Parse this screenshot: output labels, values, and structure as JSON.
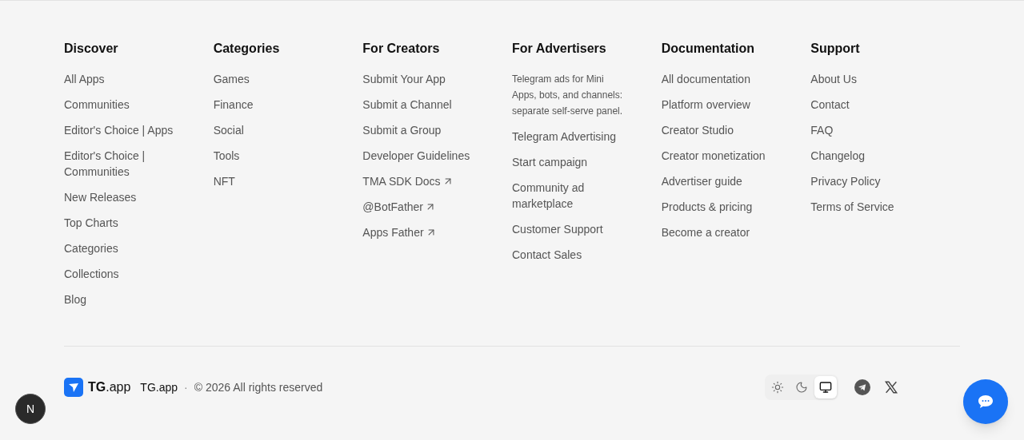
{
  "columns": [
    {
      "heading": "Discover",
      "links": [
        {
          "label": "All Apps",
          "external": false
        },
        {
          "label": "Communities",
          "external": false
        },
        {
          "label": "Editor's Choice | Apps",
          "external": false
        },
        {
          "label": "Editor's Choice | Communities",
          "external": false
        },
        {
          "label": "New Releases",
          "external": false
        },
        {
          "label": "Top Charts",
          "external": false
        },
        {
          "label": "Categories",
          "external": false
        },
        {
          "label": "Collections",
          "external": false
        },
        {
          "label": "Blog",
          "external": false
        }
      ]
    },
    {
      "heading": "Categories",
      "links": [
        {
          "label": "Games",
          "external": false
        },
        {
          "label": "Finance",
          "external": false
        },
        {
          "label": "Social",
          "external": false
        },
        {
          "label": "Tools",
          "external": false
        },
        {
          "label": "NFT",
          "external": false
        }
      ]
    },
    {
      "heading": "For Creators",
      "links": [
        {
          "label": "Submit Your App",
          "external": false
        },
        {
          "label": "Submit a Channel",
          "external": false
        },
        {
          "label": "Submit a Group",
          "external": false
        },
        {
          "label": "Developer Guidelines",
          "external": false
        },
        {
          "label": "TMA SDK Docs",
          "external": true
        },
        {
          "label": "@BotFather",
          "external": true
        },
        {
          "label": "Apps Father",
          "external": true
        }
      ]
    },
    {
      "heading": "For Advertisers",
      "description": "Telegram ads for Mini Apps, bots, and channels: separate self-serve panel.",
      "links": [
        {
          "label": "Telegram Advertising",
          "external": false
        },
        {
          "label": "Start campaign",
          "external": false
        },
        {
          "label": "Community ad marketplace",
          "external": false
        },
        {
          "label": "Customer Support",
          "external": false
        },
        {
          "label": "Contact Sales",
          "external": false
        }
      ]
    },
    {
      "heading": "Documentation",
      "links": [
        {
          "label": "All documentation",
          "external": false
        },
        {
          "label": "Platform overview",
          "external": false
        },
        {
          "label": "Creator Studio",
          "external": false
        },
        {
          "label": "Creator monetization",
          "external": false
        },
        {
          "label": "Advertiser guide",
          "external": false
        },
        {
          "label": "Products & pricing",
          "external": false
        },
        {
          "label": "Become a creator",
          "external": false
        }
      ]
    },
    {
      "heading": "Support",
      "links": [
        {
          "label": "About Us",
          "external": false
        },
        {
          "label": "Contact",
          "external": false
        },
        {
          "label": "FAQ",
          "external": false
        },
        {
          "label": "Changelog",
          "external": false
        },
        {
          "label": "Privacy Policy",
          "external": false
        },
        {
          "label": "Terms of Service",
          "external": false
        }
      ]
    }
  ],
  "bottom": {
    "logo": "**TG**.app",
    "brand": "TG.app",
    "separator": "·",
    "copyright": "© 2026 All rights reserved",
    "theme_options": [
      {
        "kind": "light",
        "selected": false
      },
      {
        "kind": "dark",
        "selected": false
      },
      {
        "kind": "system",
        "selected": true
      }
    ],
    "social": [
      {
        "kind": "telegram"
      },
      {
        "kind": "x"
      }
    ]
  },
  "dev_badge": "N"
}
